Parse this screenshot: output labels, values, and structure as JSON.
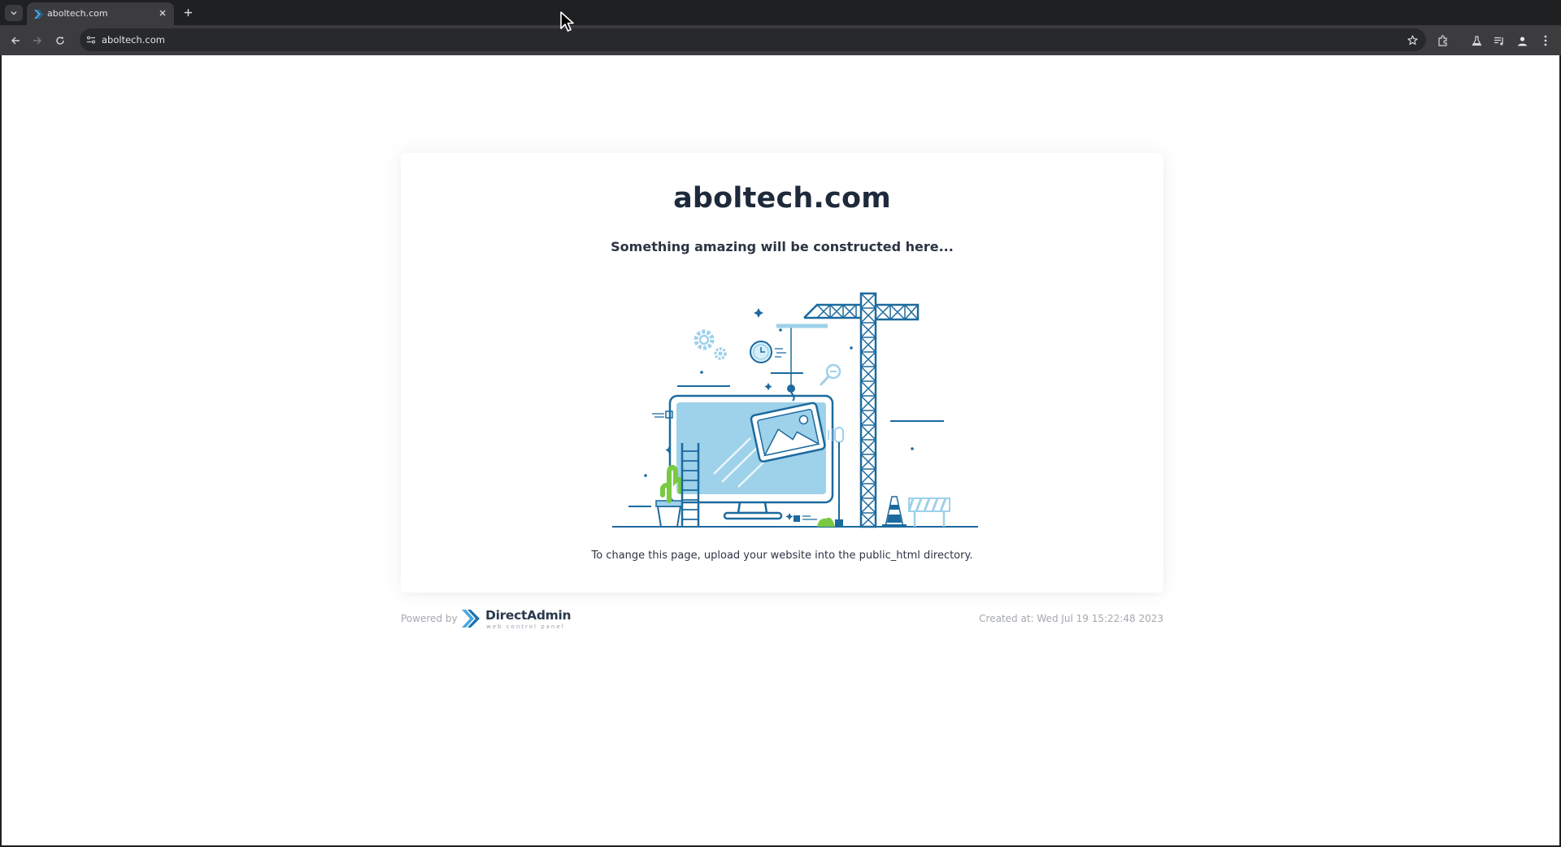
{
  "browser": {
    "tab": {
      "title": "aboltech.com",
      "favicon": "directadmin-favicon-icon"
    },
    "address_bar": {
      "url": "aboltech.com"
    },
    "icons": [
      "tab-list-icon",
      "close-icon",
      "new-tab-icon",
      "back-icon",
      "forward-icon",
      "reload-icon",
      "site-info-icon",
      "bookmark-star-icon",
      "extensions-icon",
      "labs-flask-icon",
      "media-control-icon",
      "profile-icon",
      "more-menu-icon"
    ]
  },
  "page": {
    "title": "aboltech.com",
    "subtitle": "Something amazing will be constructed here...",
    "illustration": "under-construction-illustration",
    "hint": "To change this page, upload your website into the public_html directory."
  },
  "footer": {
    "powered_by": "Powered by",
    "logo_name": "DirectAdmin",
    "logo_tagline": "web control panel",
    "created": "Created at: Wed Jul 19 15:22:48 2023"
  },
  "colors": {
    "chrome_dark": "#1f2022",
    "toolbar": "#3c3c3f",
    "title_text": "#1e2a3b",
    "illustration_blue": "#1c6a9e",
    "illustration_light": "#9ed1ea",
    "plant_green": "#79c943",
    "logo_blue": "#1d8fd3"
  }
}
